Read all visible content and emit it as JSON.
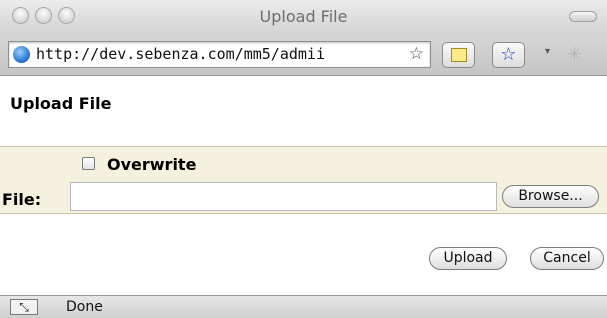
{
  "window": {
    "title": "Upload File"
  },
  "toolbar": {
    "url": "http://dev.sebenza.com/mm5/admii",
    "url_star_icon": "star-outline-icon",
    "notes_icon": "notepad-icon",
    "bookmark_icon": "star-bookmark-icon",
    "bookmark_glyph": "☆",
    "star_glyph": "☆",
    "caret_glyph": "▾",
    "spinner_glyph": "✳"
  },
  "page": {
    "heading": "Upload File"
  },
  "form": {
    "overwrite_label": "Overwrite",
    "overwrite_checked": false,
    "file_label": "File:",
    "file_value": "",
    "browse_label": "Browse..."
  },
  "actions": {
    "upload_label": "Upload",
    "cancel_label": "Cancel"
  },
  "status": {
    "text": "Done",
    "icon_glyph": "⤡"
  },
  "colors": {
    "panel_background": "#f4f1de",
    "bookmark_blue": "#1f3fd1"
  }
}
